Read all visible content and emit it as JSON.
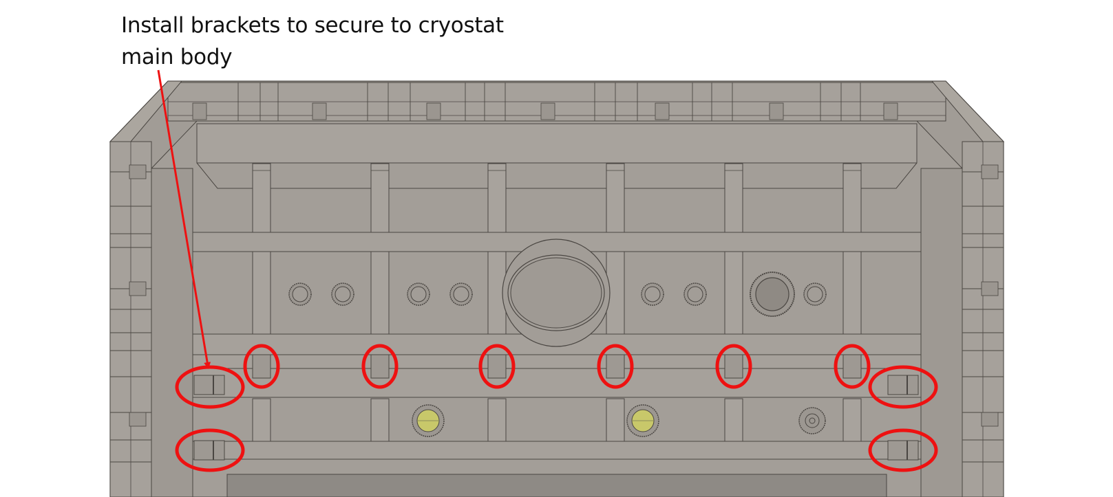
{
  "callout": {
    "line1": "Install brackets to secure to cryostat",
    "line2": "main body",
    "arrow_color": "#ee1111"
  },
  "highlight": {
    "color": "#ee1111",
    "circled_bracket_count": 10
  },
  "colors": {
    "body_fill": "#a19c96",
    "body_shadow": "#8f8a84",
    "line": "#4a4642",
    "lens_yellow": "#c8c86a"
  }
}
